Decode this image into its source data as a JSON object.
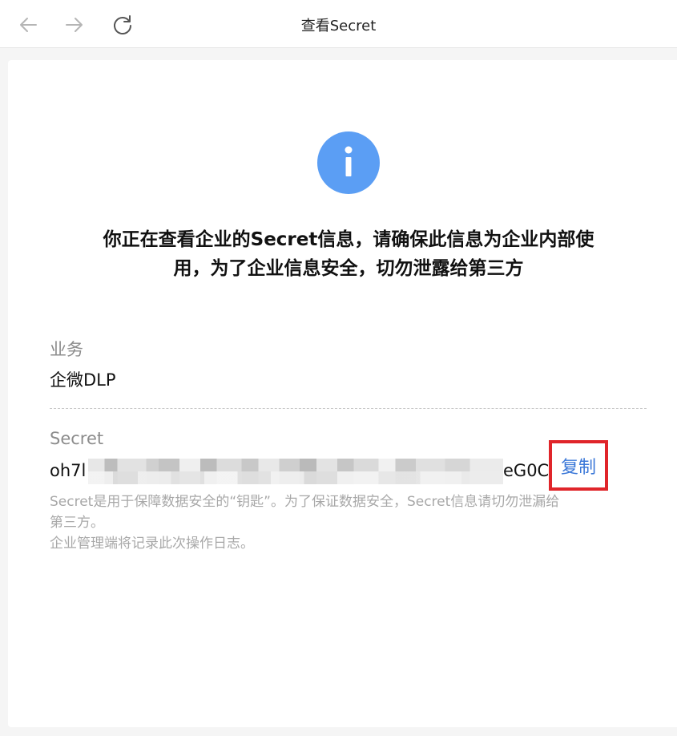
{
  "window": {
    "title": "查看Secret"
  },
  "nav": {
    "back_icon": "arrow-left-icon",
    "forward_icon": "arrow-right-icon",
    "reload_icon": "reload-icon"
  },
  "notice": {
    "icon": "info-icon",
    "icon_color": "#5b9ef4",
    "line1": "你正在查看企业的Secret信息，请确保此信息为企业内部使",
    "line2": "用，为了企业信息安全，切勿泄露给第三方"
  },
  "business": {
    "label": "业务",
    "value": "企微DLP"
  },
  "secret": {
    "label": "Secret",
    "value_prefix": "oh7l",
    "value_suffix": "eG0C",
    "copy_label": "复制",
    "highlight_color": "#e0252a",
    "link_color": "#3b78d8"
  },
  "hint": {
    "line1": "Secret是用于保障数据安全的“钥匙”。为了保证数据安全，Secret信息请切勿泄漏给",
    "line2": "第三方。",
    "line3": "企业管理端将记录此次操作日志。"
  }
}
